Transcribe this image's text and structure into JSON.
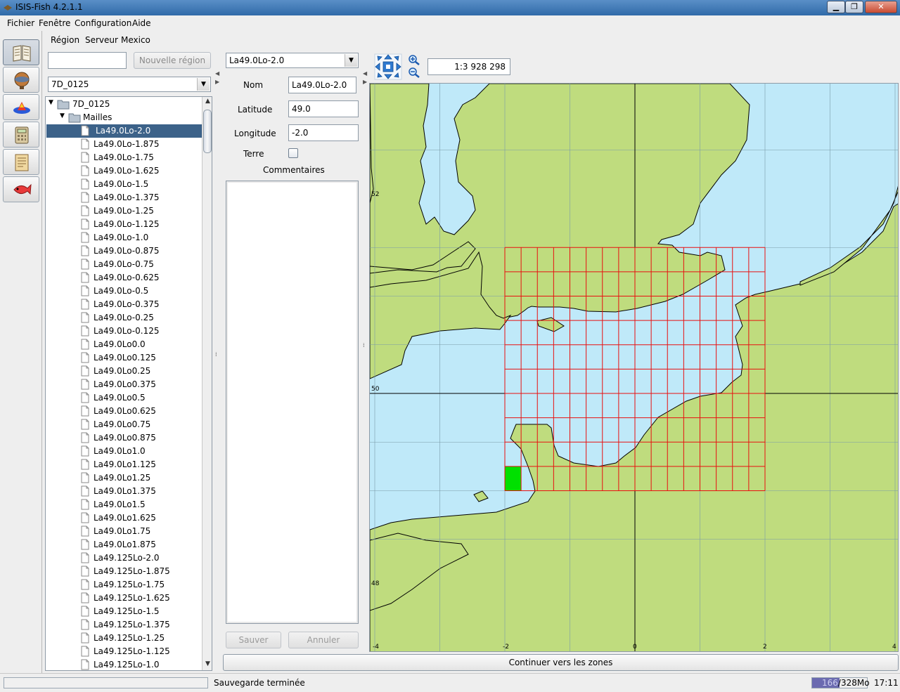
{
  "window": {
    "title": "ISIS-Fish 4.2.1.1"
  },
  "menubar": {
    "items": [
      "Fichier",
      "Fenêtre",
      "Configuration",
      "Aide"
    ]
  },
  "submenu": {
    "items": [
      "Région",
      "Serveur",
      "Mexico"
    ]
  },
  "toolstrip": {
    "icons": [
      "book-icon",
      "globe-icon",
      "fish-school-icon",
      "calculator-icon",
      "notepad-icon",
      "fish-icon"
    ]
  },
  "left_panel": {
    "search_value": "",
    "new_region_label": "Nouvelle région",
    "region_selected": "7D_0125",
    "tree": {
      "root": "7D_0125",
      "folder": "Mailles",
      "items": [
        "La49.0Lo-2.0",
        "La49.0Lo-1.875",
        "La49.0Lo-1.75",
        "La49.0Lo-1.625",
        "La49.0Lo-1.5",
        "La49.0Lo-1.375",
        "La49.0Lo-1.25",
        "La49.0Lo-1.125",
        "La49.0Lo-1.0",
        "La49.0Lo-0.875",
        "La49.0Lo-0.75",
        "La49.0Lo-0.625",
        "La49.0Lo-0.5",
        "La49.0Lo-0.375",
        "La49.0Lo-0.25",
        "La49.0Lo-0.125",
        "La49.0Lo0.0",
        "La49.0Lo0.125",
        "La49.0Lo0.25",
        "La49.0Lo0.375",
        "La49.0Lo0.5",
        "La49.0Lo0.625",
        "La49.0Lo0.75",
        "La49.0Lo0.875",
        "La49.0Lo1.0",
        "La49.0Lo1.125",
        "La49.0Lo1.25",
        "La49.0Lo1.375",
        "La49.0Lo1.5",
        "La49.0Lo1.625",
        "La49.0Lo1.75",
        "La49.0Lo1.875",
        "La49.125Lo-2.0",
        "La49.125Lo-1.875",
        "La49.125Lo-1.75",
        "La49.125Lo-1.625",
        "La49.125Lo-1.5",
        "La49.125Lo-1.375",
        "La49.125Lo-1.25",
        "La49.125Lo-1.125",
        "La49.125Lo-1.0"
      ],
      "selected_index": 0
    }
  },
  "middle_panel": {
    "cell_selected": "La49.0Lo-2.0",
    "nom_label": "Nom",
    "nom_value": "La49.0Lo-2.0",
    "latitude_label": "Latitude",
    "latitude_value": "49.0",
    "longitude_label": "Longitude",
    "longitude_value": "-2.0",
    "terre_label": "Terre",
    "terre_checked": false,
    "commentaires_label": "Commentaires",
    "commentaires_value": "",
    "save_label": "Sauver",
    "cancel_label": "Annuler"
  },
  "map": {
    "scale": "1:3 928 298",
    "lat_labels": [
      "52",
      "50",
      "48"
    ],
    "lon_labels": [
      "-4",
      "-2",
      "0",
      "2",
      "4"
    ],
    "grid_lon_range": [
      -2,
      2
    ],
    "grid_lat_range": [
      49,
      51.5
    ],
    "grid_cell_size_deg": [
      0.25,
      0.25
    ],
    "selected_cell": {
      "lat": 49.0,
      "lon": -2.0
    },
    "colors": {
      "land": "#bfdc7e",
      "sea": "#bfe9f9",
      "grid": "#e81010",
      "selected": "#00e000",
      "graticule": "#7a9aa8"
    }
  },
  "continue_label": "Continuer vers les zones",
  "status": {
    "message": "Sauvegarde terminée",
    "memory_used": "166",
    "memory_rest": "/3",
    "memory_tail": "28Mo",
    "memory_fraction": 0.5,
    "clock": "17:11"
  }
}
